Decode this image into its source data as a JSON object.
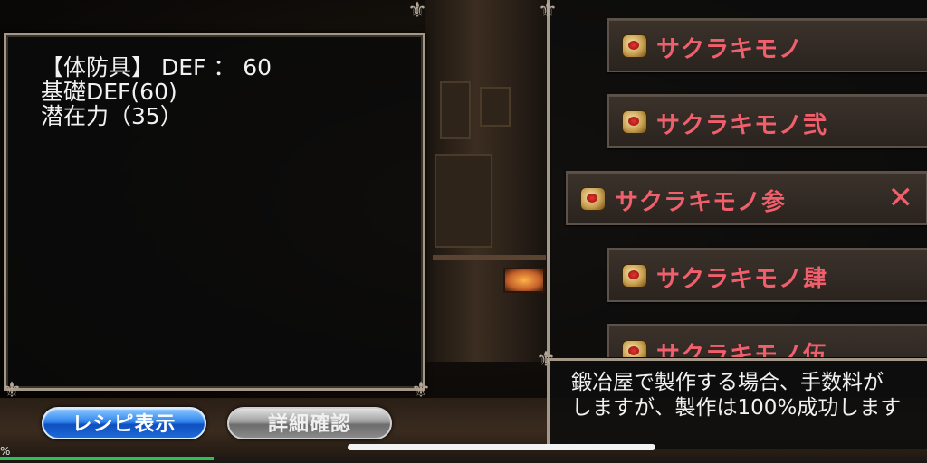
{
  "info_panel": {
    "line1": "【体防具】 DEF ： 60",
    "line2": "基礎DEF(60)",
    "line3": "潜在力（35）"
  },
  "item_list": [
    {
      "label": "サクラキモノ",
      "selected": false
    },
    {
      "label": "サクラキモノ弐",
      "selected": false
    },
    {
      "label": "サクラキモノ参",
      "selected": true
    },
    {
      "label": "サクラキモノ肆",
      "selected": false
    },
    {
      "label": "サクラキモノ伍",
      "selected": false
    }
  ],
  "close_symbol": "✕",
  "message": {
    "line1": "鍛冶屋で製作する場合、手数料が",
    "line2": "しますが、製作は100%成功します"
  },
  "buttons": {
    "recipe": "レシピ表示",
    "details": "詳細確認"
  },
  "progress": {
    "label": "%",
    "value": 0.23
  },
  "colors": {
    "item_text": "#f25f6c",
    "blue_button": "#2f86ee",
    "grey_button": "#9e9e9e"
  },
  "icons": {
    "item": "crest-icon",
    "close": "close-icon",
    "ornament": "ornament-icon"
  }
}
